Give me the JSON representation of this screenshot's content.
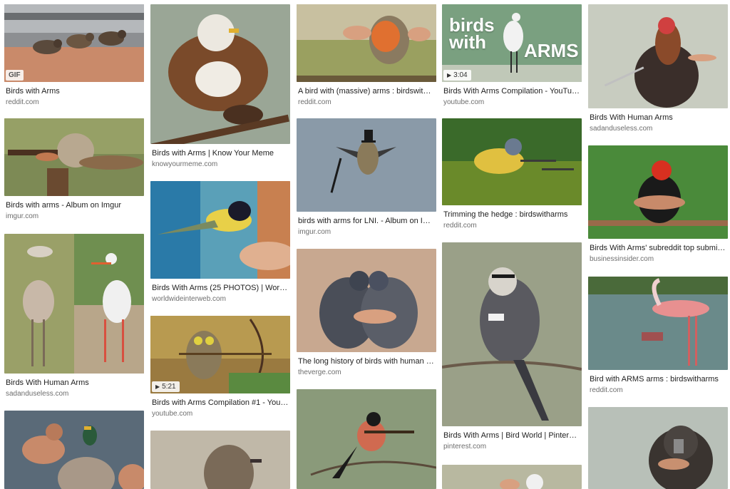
{
  "results": {
    "col1": [
      {
        "title": "Birds with Arms",
        "domain": "reddit.com",
        "badge": "GIF"
      },
      {
        "title": "Birds with arms - Album on Imgur",
        "domain": "imgur.com"
      },
      {
        "title": "Birds With Human Arms",
        "domain": "sadanduseless.com"
      },
      {
        "title": "",
        "domain": ""
      }
    ],
    "col2": [
      {
        "title": "Birds with Arms | Know Your Meme",
        "domain": "knowyourmeme.com"
      },
      {
        "title": "Birds With Arms (25 PHOTOS) | World...",
        "domain": "worldwideinterweb.com"
      },
      {
        "title": "Birds with Arms Compilation #1 - YouT...",
        "domain": "youtube.com",
        "duration": "5:21"
      },
      {
        "title": "",
        "domain": ""
      }
    ],
    "col3": [
      {
        "title": "A bird with (massive) arms : birdswitha...",
        "domain": "reddit.com"
      },
      {
        "title": "birds with arms for LNI. - Album on Imgur",
        "domain": "imgur.com"
      },
      {
        "title": "The long history of birds with human ar...",
        "domain": "theverge.com"
      },
      {
        "title": "",
        "domain": ""
      }
    ],
    "col4": [
      {
        "title": "Birds With Arms Compilation - YouTube",
        "domain": "youtube.com",
        "duration": "3:04",
        "overlay": [
          "birds",
          "with",
          "ARMS"
        ]
      },
      {
        "title": "Trimming the hedge : birdswitharms",
        "domain": "reddit.com"
      },
      {
        "title": "Birds With Arms | Bird World | Pinteres...",
        "domain": "pinterest.com"
      },
      {
        "title": "",
        "domain": ""
      }
    ],
    "col5": [
      {
        "title": "Birds With Human Arms",
        "domain": "sadanduseless.com"
      },
      {
        "title": "Birds With Arms' subreddit top submis...",
        "domain": "businessinsider.com"
      },
      {
        "title": "Bird with ARMS arms : birdswitharms",
        "domain": "reddit.com"
      },
      {
        "title": "",
        "domain": ""
      }
    ]
  },
  "icons": {
    "play": "play-icon"
  },
  "colors": {
    "title": "#222222",
    "domain": "#6e6e6e",
    "background": "#ffffff"
  }
}
